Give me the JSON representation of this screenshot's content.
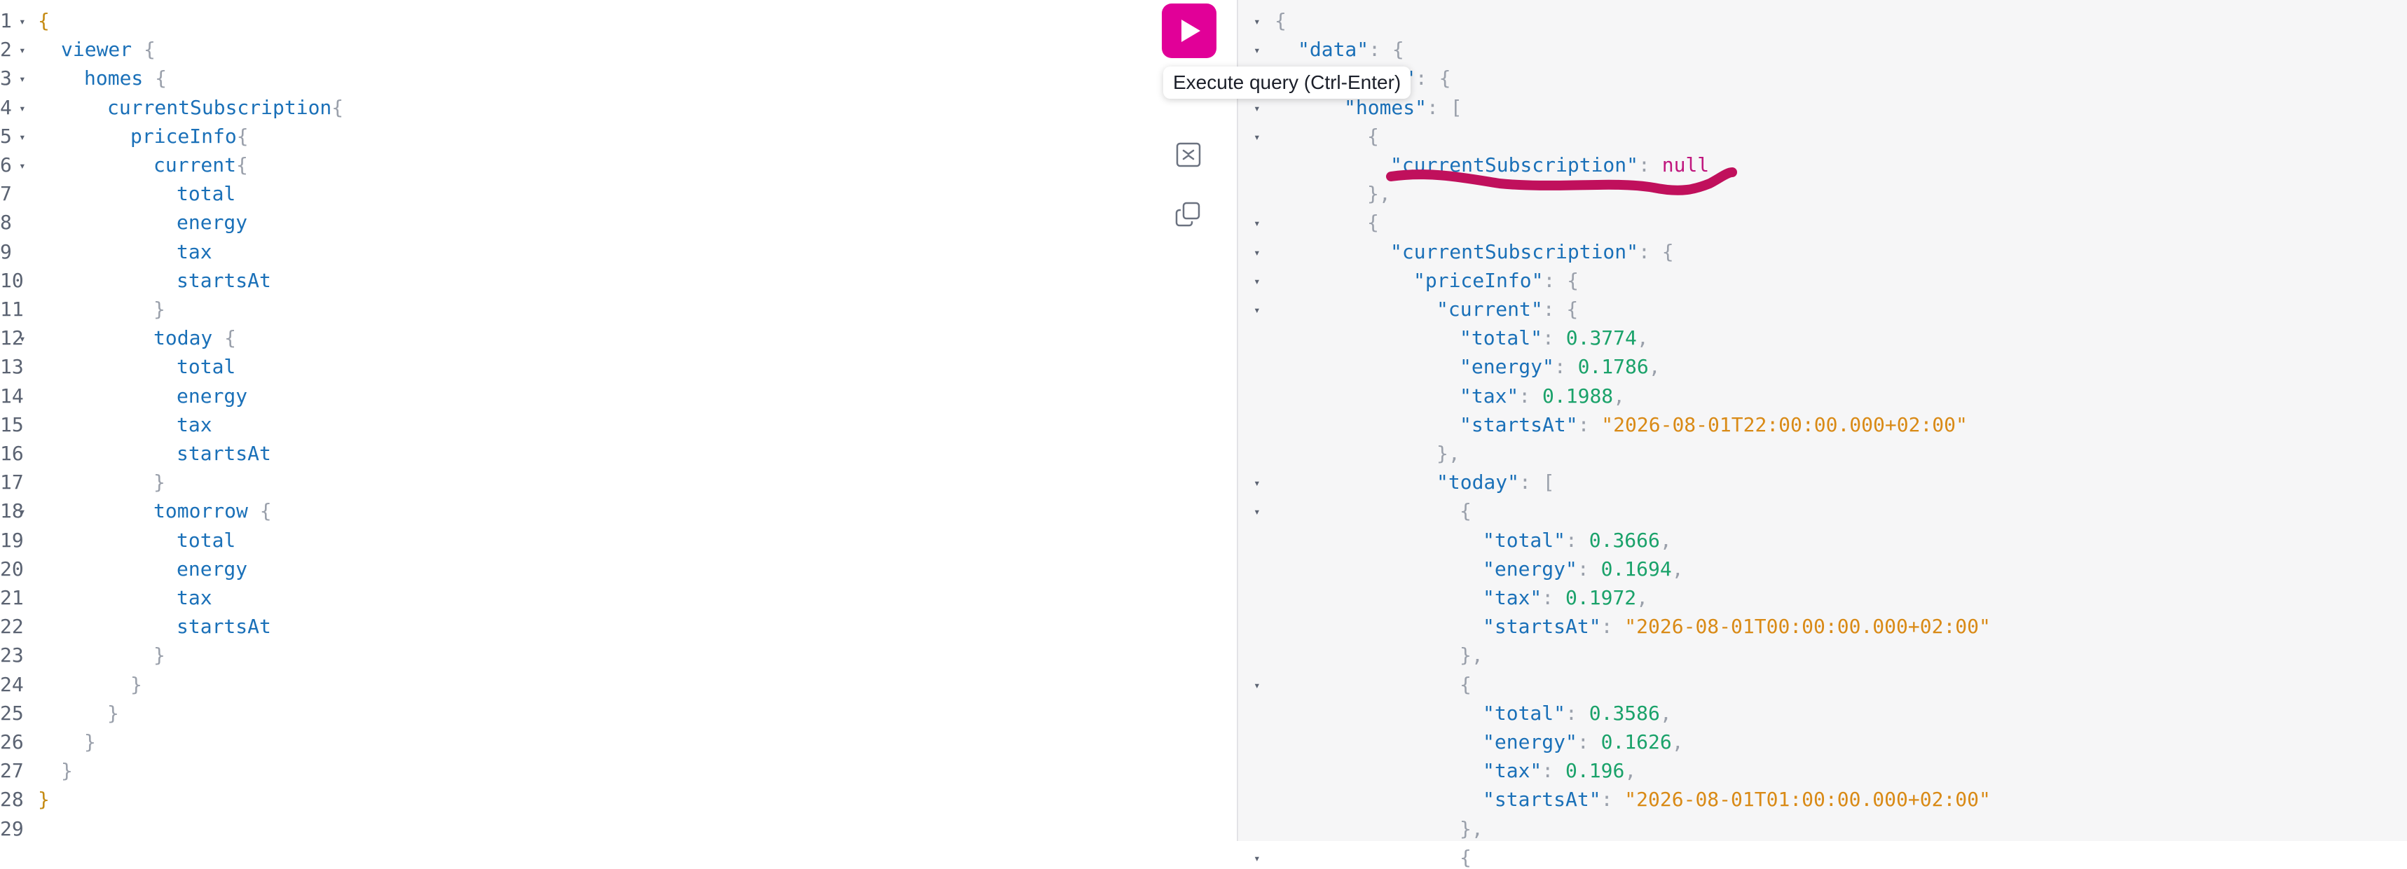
{
  "toolbar": {
    "tooltip": "Execute query (Ctrl-Enter)",
    "run_icon": "play-icon",
    "tool_icons": [
      "prettify-icon",
      "merge-fragments-icon",
      "copy-icon"
    ]
  },
  "colors": {
    "run_button": "#e10098",
    "field": "#1a70b8",
    "number": "#1aa26a",
    "string": "#d98a16",
    "null": "#c0177e",
    "punct": "#9aa0ab",
    "annotation": "#c0105c"
  },
  "editor": {
    "lines": [
      {
        "n": "1",
        "fold": true,
        "indent": 0,
        "segs": [
          {
            "t": "{",
            "c": "brace"
          }
        ]
      },
      {
        "n": "2",
        "fold": true,
        "indent": 1,
        "segs": [
          {
            "t": "viewer",
            "c": "field"
          },
          {
            "t": " {",
            "c": "punct"
          }
        ]
      },
      {
        "n": "3",
        "fold": true,
        "indent": 2,
        "segs": [
          {
            "t": "homes",
            "c": "field"
          },
          {
            "t": " {",
            "c": "punct"
          }
        ]
      },
      {
        "n": "4",
        "fold": true,
        "indent": 3,
        "segs": [
          {
            "t": "currentSubscription",
            "c": "field"
          },
          {
            "t": "{",
            "c": "punct"
          }
        ]
      },
      {
        "n": "5",
        "fold": true,
        "indent": 4,
        "segs": [
          {
            "t": "priceInfo",
            "c": "field"
          },
          {
            "t": "{",
            "c": "punct"
          }
        ]
      },
      {
        "n": "6",
        "fold": true,
        "indent": 5,
        "segs": [
          {
            "t": "current",
            "c": "field"
          },
          {
            "t": "{",
            "c": "punct"
          }
        ]
      },
      {
        "n": "7",
        "fold": false,
        "indent": 6,
        "segs": [
          {
            "t": "total",
            "c": "field"
          }
        ]
      },
      {
        "n": "8",
        "fold": false,
        "indent": 6,
        "segs": [
          {
            "t": "energy",
            "c": "field"
          }
        ]
      },
      {
        "n": "9",
        "fold": false,
        "indent": 6,
        "segs": [
          {
            "t": "tax",
            "c": "field"
          }
        ]
      },
      {
        "n": "10",
        "fold": false,
        "indent": 6,
        "segs": [
          {
            "t": "startsAt",
            "c": "field"
          }
        ]
      },
      {
        "n": "11",
        "fold": false,
        "indent": 5,
        "segs": [
          {
            "t": "}",
            "c": "punct"
          }
        ]
      },
      {
        "n": "12",
        "fold": true,
        "indent": 5,
        "segs": [
          {
            "t": "today",
            "c": "field"
          },
          {
            "t": " {",
            "c": "punct"
          }
        ]
      },
      {
        "n": "13",
        "fold": false,
        "indent": 6,
        "segs": [
          {
            "t": "total",
            "c": "field"
          }
        ]
      },
      {
        "n": "14",
        "fold": false,
        "indent": 6,
        "segs": [
          {
            "t": "energy",
            "c": "field"
          }
        ]
      },
      {
        "n": "15",
        "fold": false,
        "indent": 6,
        "segs": [
          {
            "t": "tax",
            "c": "field"
          }
        ]
      },
      {
        "n": "16",
        "fold": false,
        "indent": 6,
        "segs": [
          {
            "t": "startsAt",
            "c": "field"
          }
        ]
      },
      {
        "n": "17",
        "fold": false,
        "indent": 5,
        "segs": [
          {
            "t": "}",
            "c": "punct"
          }
        ]
      },
      {
        "n": "18",
        "fold": true,
        "indent": 5,
        "segs": [
          {
            "t": "tomorrow",
            "c": "field"
          },
          {
            "t": " {",
            "c": "punct"
          }
        ]
      },
      {
        "n": "19",
        "fold": false,
        "indent": 6,
        "segs": [
          {
            "t": "total",
            "c": "field"
          }
        ]
      },
      {
        "n": "20",
        "fold": false,
        "indent": 6,
        "segs": [
          {
            "t": "energy",
            "c": "field"
          }
        ]
      },
      {
        "n": "21",
        "fold": false,
        "indent": 6,
        "segs": [
          {
            "t": "tax",
            "c": "field"
          }
        ]
      },
      {
        "n": "22",
        "fold": false,
        "indent": 6,
        "segs": [
          {
            "t": "startsAt",
            "c": "field"
          }
        ]
      },
      {
        "n": "23",
        "fold": false,
        "indent": 5,
        "segs": [
          {
            "t": "}",
            "c": "punct"
          }
        ]
      },
      {
        "n": "24",
        "fold": false,
        "indent": 4,
        "segs": [
          {
            "t": "}",
            "c": "punct"
          }
        ]
      },
      {
        "n": "25",
        "fold": false,
        "indent": 3,
        "segs": [
          {
            "t": "}",
            "c": "punct"
          }
        ]
      },
      {
        "n": "26",
        "fold": false,
        "indent": 2,
        "segs": [
          {
            "t": "}",
            "c": "punct"
          }
        ]
      },
      {
        "n": "27",
        "fold": false,
        "indent": 1,
        "segs": [
          {
            "t": "}",
            "c": "punct"
          }
        ]
      },
      {
        "n": "28",
        "fold": false,
        "indent": 0,
        "segs": [
          {
            "t": "}",
            "c": "brace"
          }
        ]
      },
      {
        "n": "29",
        "fold": false,
        "indent": 0,
        "segs": []
      }
    ]
  },
  "result": {
    "lines": [
      {
        "fold": true,
        "indent": 0,
        "segs": [
          {
            "t": "{",
            "c": "punct"
          }
        ]
      },
      {
        "fold": true,
        "indent": 1,
        "segs": [
          {
            "t": "\"data\"",
            "c": "key"
          },
          {
            "t": ": {",
            "c": "punct"
          }
        ]
      },
      {
        "fold": true,
        "indent": 2,
        "segs": [
          {
            "t": "\"viewer\"",
            "c": "key"
          },
          {
            "t": ": {",
            "c": "punct"
          }
        ]
      },
      {
        "fold": true,
        "indent": 3,
        "segs": [
          {
            "t": "\"homes\"",
            "c": "key"
          },
          {
            "t": ": [",
            "c": "punct"
          }
        ]
      },
      {
        "fold": true,
        "indent": 4,
        "segs": [
          {
            "t": "{",
            "c": "punct"
          }
        ]
      },
      {
        "fold": false,
        "indent": 5,
        "segs": [
          {
            "t": "\"currentSubscription\"",
            "c": "key"
          },
          {
            "t": ": ",
            "c": "punct"
          },
          {
            "t": "null",
            "c": "null"
          }
        ]
      },
      {
        "fold": false,
        "indent": 4,
        "segs": [
          {
            "t": "},",
            "c": "punct"
          }
        ]
      },
      {
        "fold": true,
        "indent": 4,
        "segs": [
          {
            "t": "{",
            "c": "punct"
          }
        ]
      },
      {
        "fold": true,
        "indent": 5,
        "segs": [
          {
            "t": "\"currentSubscription\"",
            "c": "key"
          },
          {
            "t": ": {",
            "c": "punct"
          }
        ]
      },
      {
        "fold": true,
        "indent": 6,
        "segs": [
          {
            "t": "\"priceInfo\"",
            "c": "key"
          },
          {
            "t": ": {",
            "c": "punct"
          }
        ]
      },
      {
        "fold": true,
        "indent": 7,
        "segs": [
          {
            "t": "\"current\"",
            "c": "key"
          },
          {
            "t": ": {",
            "c": "punct"
          }
        ]
      },
      {
        "fold": false,
        "indent": 8,
        "segs": [
          {
            "t": "\"total\"",
            "c": "key"
          },
          {
            "t": ": ",
            "c": "punct"
          },
          {
            "t": "0.3774",
            "c": "num"
          },
          {
            "t": ",",
            "c": "punct"
          }
        ]
      },
      {
        "fold": false,
        "indent": 8,
        "segs": [
          {
            "t": "\"energy\"",
            "c": "key"
          },
          {
            "t": ": ",
            "c": "punct"
          },
          {
            "t": "0.1786",
            "c": "num"
          },
          {
            "t": ",",
            "c": "punct"
          }
        ]
      },
      {
        "fold": false,
        "indent": 8,
        "segs": [
          {
            "t": "\"tax\"",
            "c": "key"
          },
          {
            "t": ": ",
            "c": "punct"
          },
          {
            "t": "0.1988",
            "c": "num"
          },
          {
            "t": ",",
            "c": "punct"
          }
        ]
      },
      {
        "fold": false,
        "indent": 8,
        "segs": [
          {
            "t": "\"startsAt\"",
            "c": "key"
          },
          {
            "t": ": ",
            "c": "punct"
          },
          {
            "t": "\"2026-08-01T22:00:00.000+02:00\"",
            "c": "str"
          }
        ]
      },
      {
        "fold": false,
        "indent": 7,
        "segs": [
          {
            "t": "},",
            "c": "punct"
          }
        ]
      },
      {
        "fold": true,
        "indent": 7,
        "segs": [
          {
            "t": "\"today\"",
            "c": "key"
          },
          {
            "t": ": [",
            "c": "punct"
          }
        ]
      },
      {
        "fold": true,
        "indent": 8,
        "segs": [
          {
            "t": "{",
            "c": "punct"
          }
        ]
      },
      {
        "fold": false,
        "indent": 9,
        "segs": [
          {
            "t": "\"total\"",
            "c": "key"
          },
          {
            "t": ": ",
            "c": "punct"
          },
          {
            "t": "0.3666",
            "c": "num"
          },
          {
            "t": ",",
            "c": "punct"
          }
        ]
      },
      {
        "fold": false,
        "indent": 9,
        "segs": [
          {
            "t": "\"energy\"",
            "c": "key"
          },
          {
            "t": ": ",
            "c": "punct"
          },
          {
            "t": "0.1694",
            "c": "num"
          },
          {
            "t": ",",
            "c": "punct"
          }
        ]
      },
      {
        "fold": false,
        "indent": 9,
        "segs": [
          {
            "t": "\"tax\"",
            "c": "key"
          },
          {
            "t": ": ",
            "c": "punct"
          },
          {
            "t": "0.1972",
            "c": "num"
          },
          {
            "t": ",",
            "c": "punct"
          }
        ]
      },
      {
        "fold": false,
        "indent": 9,
        "segs": [
          {
            "t": "\"startsAt\"",
            "c": "key"
          },
          {
            "t": ": ",
            "c": "punct"
          },
          {
            "t": "\"2026-08-01T00:00:00.000+02:00\"",
            "c": "str"
          }
        ]
      },
      {
        "fold": false,
        "indent": 8,
        "segs": [
          {
            "t": "},",
            "c": "punct"
          }
        ]
      },
      {
        "fold": true,
        "indent": 8,
        "segs": [
          {
            "t": "{",
            "c": "punct"
          }
        ]
      },
      {
        "fold": false,
        "indent": 9,
        "segs": [
          {
            "t": "\"total\"",
            "c": "key"
          },
          {
            "t": ": ",
            "c": "punct"
          },
          {
            "t": "0.3586",
            "c": "num"
          },
          {
            "t": ",",
            "c": "punct"
          }
        ]
      },
      {
        "fold": false,
        "indent": 9,
        "segs": [
          {
            "t": "\"energy\"",
            "c": "key"
          },
          {
            "t": ": ",
            "c": "punct"
          },
          {
            "t": "0.1626",
            "c": "num"
          },
          {
            "t": ",",
            "c": "punct"
          }
        ]
      },
      {
        "fold": false,
        "indent": 9,
        "segs": [
          {
            "t": "\"tax\"",
            "c": "key"
          },
          {
            "t": ": ",
            "c": "punct"
          },
          {
            "t": "0.196",
            "c": "num"
          },
          {
            "t": ",",
            "c": "punct"
          }
        ]
      },
      {
        "fold": false,
        "indent": 9,
        "segs": [
          {
            "t": "\"startsAt\"",
            "c": "key"
          },
          {
            "t": ": ",
            "c": "punct"
          },
          {
            "t": "\"2026-08-01T01:00:00.000+02:00\"",
            "c": "str"
          }
        ]
      },
      {
        "fold": false,
        "indent": 8,
        "segs": [
          {
            "t": "},",
            "c": "punct"
          }
        ]
      },
      {
        "fold": true,
        "indent": 8,
        "segs": [
          {
            "t": "{",
            "c": "punct"
          }
        ]
      }
    ]
  }
}
